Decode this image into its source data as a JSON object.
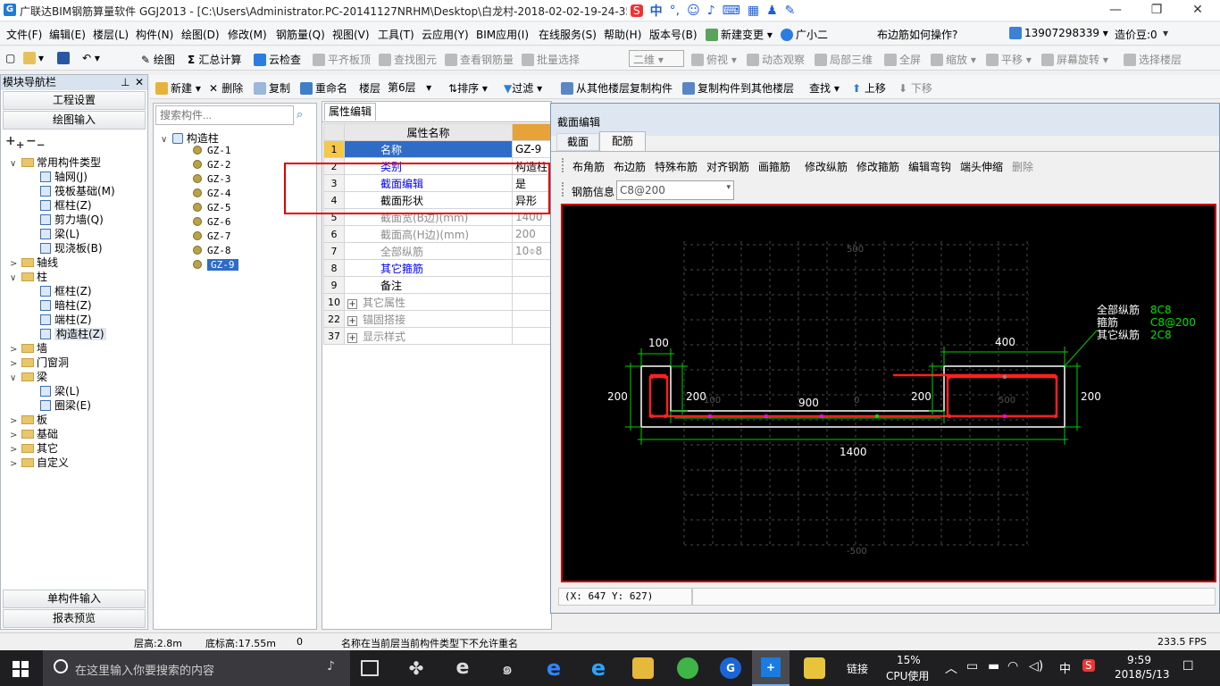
{
  "window": {
    "title": "广联达BIM钢筋算量软件 GGJ2013 - [C:\\Users\\Administrator.PC-20141127NRHM\\Desktop\\白龙村-2018-02-02-19-24-35"
  },
  "menu": [
    "文件(F)",
    "编辑(E)",
    "楼层(L)",
    "构件(N)",
    "绘图(D)",
    "修改(M)",
    "钢筋量(Q)",
    "视图(V)",
    "工具(T)",
    "云应用(Y)",
    "BIM应用(I)",
    "在线服务(S)",
    "帮助(H)",
    "版本号(B)",
    "新建变更",
    "广小二",
    "布边筋如何操作?",
    "13907298339",
    "造价豆:0"
  ],
  "toolbar1": [
    "绘图",
    "汇总计算",
    "云检查",
    "平齐板顶",
    "查找图元",
    "查看钢筋量",
    "批量选择",
    "二维",
    "俯视",
    "动态观察",
    "局部三维",
    "全屏",
    "缩放",
    "平移",
    "屏幕旋转",
    "选择楼层"
  ],
  "toolbar2": [
    "新建",
    "删除",
    "复制",
    "重命名",
    "楼层",
    "第6层",
    "排序",
    "过滤",
    "从其他楼层复制构件",
    "复制构件到其他楼层",
    "查找",
    "上移",
    "下移"
  ],
  "nav": {
    "header": "模块导航栏",
    "buttons": [
      "工程设置",
      "绘图输入",
      "单构件输入",
      "报表预览"
    ],
    "tree": [
      {
        "label": "常用构件类型",
        "level": 0,
        "toggle": "∨",
        "type": "folder"
      },
      {
        "label": "轴网(J)",
        "level": 2,
        "type": "comp"
      },
      {
        "label": "筏板基础(M)",
        "level": 2,
        "type": "comp"
      },
      {
        "label": "框柱(Z)",
        "level": 2,
        "type": "comp"
      },
      {
        "label": "剪力墙(Q)",
        "level": 2,
        "type": "comp"
      },
      {
        "label": "梁(L)",
        "level": 2,
        "type": "comp"
      },
      {
        "label": "现浇板(B)",
        "level": 2,
        "type": "comp"
      },
      {
        "label": "轴线",
        "level": 0,
        "toggle": ">",
        "type": "folder"
      },
      {
        "label": "柱",
        "level": 0,
        "toggle": "∨",
        "type": "folder"
      },
      {
        "label": "框柱(Z)",
        "level": 2,
        "type": "comp"
      },
      {
        "label": "暗柱(Z)",
        "level": 2,
        "type": "comp"
      },
      {
        "label": "端柱(Z)",
        "level": 2,
        "type": "comp"
      },
      {
        "label": "构造柱(Z)",
        "level": 2,
        "type": "comp",
        "selected": true
      },
      {
        "label": "墙",
        "level": 0,
        "toggle": ">",
        "type": "folder"
      },
      {
        "label": "门窗洞",
        "level": 0,
        "toggle": ">",
        "type": "folder"
      },
      {
        "label": "梁",
        "level": 0,
        "toggle": "∨",
        "type": "folder"
      },
      {
        "label": "梁(L)",
        "level": 2,
        "type": "comp"
      },
      {
        "label": "圈梁(E)",
        "level": 2,
        "type": "comp"
      },
      {
        "label": "板",
        "level": 0,
        "toggle": ">",
        "type": "folder"
      },
      {
        "label": "基础",
        "level": 0,
        "toggle": ">",
        "type": "folder"
      },
      {
        "label": "其它",
        "level": 0,
        "toggle": ">",
        "type": "folder"
      },
      {
        "label": "自定义",
        "level": 0,
        "toggle": ">",
        "type": "folder"
      }
    ]
  },
  "components": {
    "search_placeholder": "搜索构件...",
    "root": "构造柱",
    "items": [
      "GZ-1",
      "GZ-2",
      "GZ-3",
      "GZ-4",
      "GZ-5",
      "GZ-6",
      "GZ-7",
      "GZ-8",
      "GZ-9"
    ],
    "selected": "GZ-9"
  },
  "props": {
    "tab": "属性编辑",
    "header": "属性名称",
    "rows": [
      {
        "no": "1",
        "name": "名称",
        "value": "GZ-9",
        "style": "blue",
        "selected": true
      },
      {
        "no": "2",
        "name": "类别",
        "value": "构造柱",
        "style": "blue"
      },
      {
        "no": "3",
        "name": "截面编辑",
        "value": "是",
        "style": "blue"
      },
      {
        "no": "4",
        "name": "截面形状",
        "value": "异形",
        "style": ""
      },
      {
        "no": "5",
        "name": "截面宽(B边)(mm)",
        "value": "1400",
        "style": "gray"
      },
      {
        "no": "6",
        "name": "截面高(H边)(mm)",
        "value": "200",
        "style": "gray"
      },
      {
        "no": "7",
        "name": "全部纵筋",
        "value": "10⌽8",
        "style": "gray"
      },
      {
        "no": "8",
        "name": "其它箍筋",
        "value": "",
        "style": "blue"
      },
      {
        "no": "9",
        "name": "备注",
        "value": "",
        "style": ""
      },
      {
        "no": "10",
        "name": "其它属性",
        "value": "",
        "style": "gray",
        "expand": "+"
      },
      {
        "no": "22",
        "name": "锚固搭接",
        "value": "",
        "style": "gray",
        "expand": "+"
      },
      {
        "no": "37",
        "name": "显示样式",
        "value": "",
        "style": "gray",
        "expand": "+"
      }
    ]
  },
  "dialog": {
    "title": "截面编辑",
    "tabs": [
      "截面",
      "配筋"
    ],
    "active_tab": "配筋",
    "tools": [
      "布角筋",
      "布边筋",
      "特殊布筋",
      "对齐钢筋",
      "画箍筋",
      "修改纵筋",
      "修改箍筋",
      "编辑弯钩",
      "端头伸缩",
      "删除"
    ],
    "rebar_info_label": "钢筋信息",
    "rebar_info_value": "C8@200",
    "legend": [
      {
        "label": "全部纵筋",
        "value": "8C8"
      },
      {
        "label": "箍筋",
        "value": "C8@200"
      },
      {
        "label": "其它纵筋",
        "value": "2C8"
      }
    ],
    "dims": {
      "left_w": "100",
      "right_w": "400",
      "left_h": "200",
      "inner_h_left": "200",
      "mid_len": "900",
      "inner_h_right": "200",
      "right_h": "200",
      "total": "1400"
    },
    "grid_labels": [
      "500",
      "100",
      "0",
      "500",
      "-500"
    ],
    "coords": "(X: 647 Y: 627)",
    "colors": {
      "frame": "#ffffff",
      "rebar": "#ff2020",
      "green": "#00e000",
      "dot": "#ff00ff"
    }
  },
  "status": {
    "floor_height": "层高:2.8m",
    "base_height": "底标高:17.55m",
    "zero": "0",
    "message": "名称在当前层当前构件类型下不允许重名",
    "fps": "233.5 FPS"
  },
  "taskbar": {
    "search": "在这里输入你要搜索的内容",
    "link": "链接",
    "cpu_pct": "15%",
    "cpu_label": "CPU使用",
    "ime": "中",
    "time": "9:59",
    "date": "2018/5/13"
  }
}
